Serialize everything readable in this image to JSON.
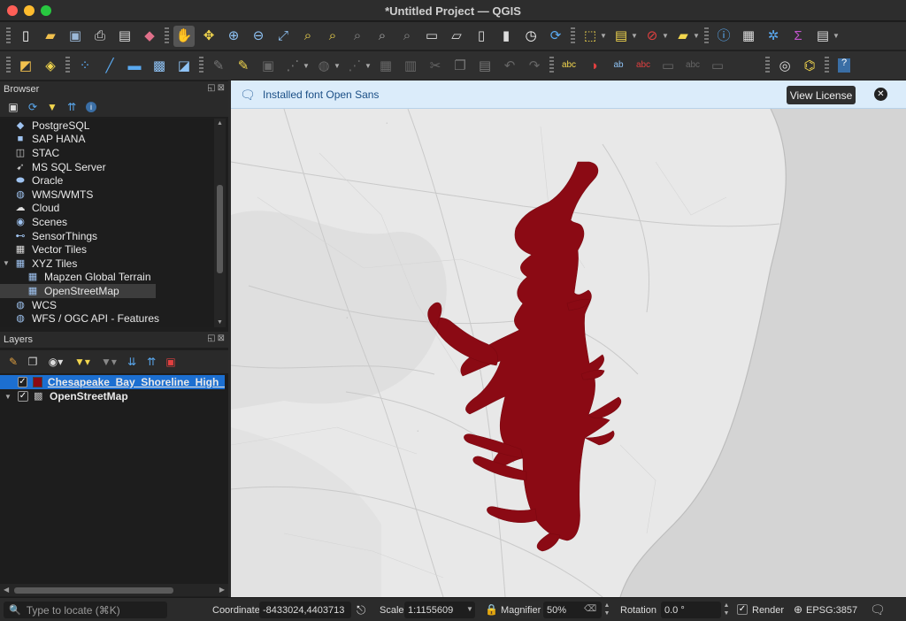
{
  "window": {
    "title": "*Untitled Project — QGIS"
  },
  "browser_panel": {
    "title": "Browser",
    "items": [
      {
        "label": "PostgreSQL",
        "icon": "postgresql-icon"
      },
      {
        "label": "SAP HANA",
        "icon": "sap-hana-icon"
      },
      {
        "label": "STAC",
        "icon": "stac-icon"
      },
      {
        "label": "MS SQL Server",
        "icon": "mssql-icon"
      },
      {
        "label": "Oracle",
        "icon": "oracle-icon"
      },
      {
        "label": "WMS/WMTS",
        "icon": "wms-icon"
      },
      {
        "label": "Cloud",
        "icon": "cloud-icon"
      },
      {
        "label": "Scenes",
        "icon": "scenes-icon"
      },
      {
        "label": "SensorThings",
        "icon": "sensorthings-icon"
      },
      {
        "label": "Vector Tiles",
        "icon": "vector-tiles-icon"
      },
      {
        "label": "XYZ Tiles",
        "icon": "xyz-tiles-icon"
      },
      {
        "label": "Mapzen Global Terrain",
        "icon": "tile-grid-icon"
      },
      {
        "label": "OpenStreetMap",
        "icon": "tile-grid-icon"
      },
      {
        "label": "WCS",
        "icon": "wcs-icon"
      },
      {
        "label": "WFS / OGC API - Features",
        "icon": "wfs-icon"
      }
    ]
  },
  "layers_panel": {
    "title": "Layers",
    "layers": [
      {
        "label": "Chesapeake_Bay_Shoreline_High_",
        "checked": true,
        "color": "#8b0a14"
      },
      {
        "label": "OpenStreetMap",
        "checked": true
      }
    ]
  },
  "message_bar": {
    "message": "Installed font Open Sans",
    "button": "View License"
  },
  "status_bar": {
    "locate_placeholder": "Type to locate (⌘K)",
    "coordinate_label": "Coordinate",
    "coordinate_value": "-8433024,4403713",
    "scale_label": "Scale",
    "scale_value": "1:1155609",
    "magnifier_label": "Magnifier",
    "magnifier_value": "50%",
    "rotation_label": "Rotation",
    "rotation_value": "0.0 °",
    "render_label": "Render",
    "crs": "EPSG:3857"
  },
  "colors": {
    "bay_fill": "#8b0a14",
    "selection": "#1c6fd1",
    "infobar_bg": "#dbecfa",
    "infobar_text": "#1b4f86"
  }
}
